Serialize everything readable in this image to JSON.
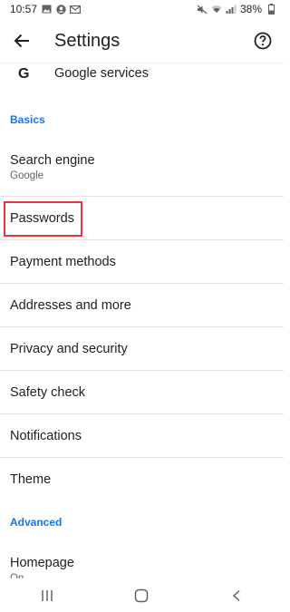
{
  "status_bar": {
    "time": "10:57",
    "battery": "38%",
    "left_icons": [
      "gallery-icon",
      "account-icon",
      "gmail-icon"
    ],
    "right_icons": [
      "mute-icon",
      "wifi-icon",
      "signal-icon",
      "battery-icon"
    ]
  },
  "app_bar": {
    "title": "Settings",
    "back_icon": "back-arrow-icon",
    "help_icon": "help-icon"
  },
  "google_services": {
    "icon": "G",
    "label": "Google services"
  },
  "sections": {
    "basics": "Basics",
    "advanced": "Advanced"
  },
  "items": {
    "search_engine": {
      "label": "Search engine",
      "sub": "Google"
    },
    "passwords": {
      "label": "Passwords"
    },
    "payment_methods": {
      "label": "Payment methods"
    },
    "addresses": {
      "label": "Addresses and more"
    },
    "privacy": {
      "label": "Privacy and security"
    },
    "safety_check": {
      "label": "Safety check"
    },
    "notifications": {
      "label": "Notifications"
    },
    "theme": {
      "label": "Theme"
    },
    "homepage": {
      "label": "Homepage",
      "sub": "On"
    }
  },
  "highlighted_item": "passwords",
  "colors": {
    "accent": "#1a73e8",
    "highlight": "#e53935",
    "divider": "#e0e0e0"
  },
  "nav_bar": {
    "icons": [
      "recents-icon",
      "home-icon",
      "back-icon"
    ]
  }
}
